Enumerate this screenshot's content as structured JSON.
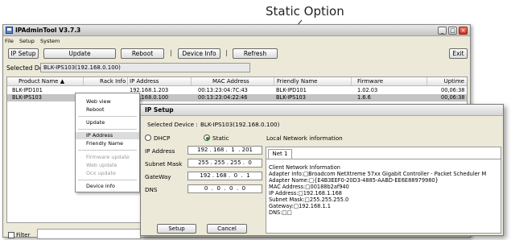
{
  "annotation": {
    "label": "Static Option"
  },
  "window": {
    "title": "IPAdminTool V3.7.3",
    "menu": [
      "File",
      "Setup",
      "System"
    ],
    "toolbar": {
      "ip_setup": "IP Setup",
      "update": "Update",
      "reboot": "Reboot",
      "separator": "|",
      "device_info": "Device Info",
      "refresh": "Refresh",
      "exit": "Exit"
    },
    "selected_device_label": "Selected Device :",
    "selected_device_value": "BLK-IPS103(192.168.0.100)",
    "columns": [
      "Product Name",
      "Rack Info",
      "IP Address",
      "MAC Address",
      "Friendly Name",
      "Firmware",
      "Uptime"
    ],
    "rows": [
      [
        "BLK-IPD101",
        "",
        "192.168.1.203",
        "00:13:23:04:7C:43",
        "BLK-IPD101",
        "1.02.03",
        "00,06:38"
      ],
      [
        "BLK-IPS103",
        "",
        "192.168.0.100",
        "00:13:23:04:22:46",
        "BLK-IPS103",
        "1.6.6",
        "00,06:38"
      ]
    ],
    "filter_label": "Filter"
  },
  "context_menu": {
    "items": [
      {
        "label": "Web view",
        "state": "normal"
      },
      {
        "label": "Reboot",
        "state": "normal"
      },
      {
        "label": "Update",
        "state": "normal"
      },
      {
        "label": "IP Address",
        "state": "highlighted"
      },
      {
        "label": "Friendly Name",
        "state": "normal"
      },
      {
        "label": "Firmware update",
        "state": "disabled"
      },
      {
        "label": "Web update",
        "state": "disabled"
      },
      {
        "label": "Ocx update",
        "state": "disabled"
      },
      {
        "label": "Device info",
        "state": "normal"
      }
    ]
  },
  "ip_setup": {
    "title": "IP Setup",
    "selected_device_label": "Selected Device :",
    "selected_device_value": "BLK-IPS103(192.168.0.100)",
    "dhcp_label": "DHCP",
    "static_label": "Static",
    "mode": "static",
    "local_network_label": "Local Network information",
    "ip_label": "IP Address",
    "ip_value": "192 . 168 .  1  . 201",
    "subnet_label": "Subnet Mask",
    "subnet_value": "255 . 255 . 255 .  0",
    "gateway_label": "GateWay",
    "gateway_value": "192 . 168 .  0  .  1",
    "dns_label": "DNS",
    "dns_value": "0  .  0  .  0  .  0",
    "tab": "Net 1",
    "net_info": [
      "Client Network Information",
      "Adapter Info:□Broadcom NetXtreme 57xx Gigabit Controller - Packet Scheduler M",
      "Adapter Name:□{E4B3EEF0-20D3-4885-AABD-EE6E88979980}",
      "MAC Address:□00188b2af940",
      "IP Address:□192.168.1.168",
      "Subnet Mask:□255.255.255.0",
      "Gateway:□192.168.1.1",
      "DNS:□□"
    ],
    "setup_button": "Setup",
    "cancel_button": "Cancel"
  },
  "colors": {
    "window_bg": "#ece9d8",
    "selected_row": "#c4c4c4",
    "radio_on": "#2a8a2a",
    "close_button": "#c83020"
  }
}
